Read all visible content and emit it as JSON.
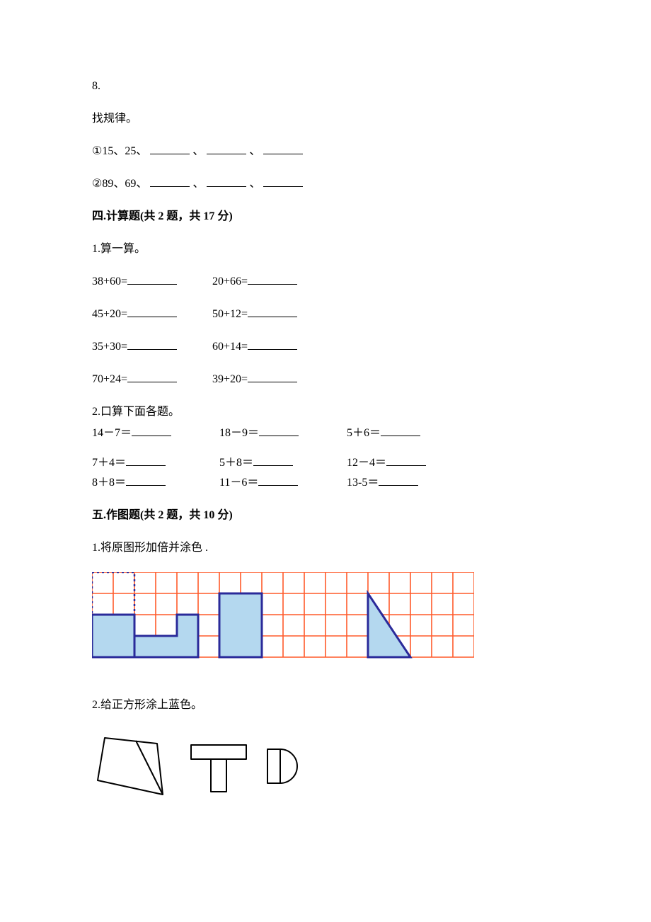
{
  "q8": {
    "number": "8.",
    "title": "找规律。",
    "seq1_prefix": "①15、25、",
    "seq2_prefix": "②89、69、",
    "sep": "、"
  },
  "section4": {
    "title": "四.计算题(共 2 题，共 17 分)",
    "q1": {
      "title": "1.算一算。",
      "rows": [
        [
          "38+60=",
          "20+66="
        ],
        [
          "45+20=",
          "50+12="
        ],
        [
          "35+30=",
          "60+14="
        ],
        [
          "70+24=",
          "39+20="
        ]
      ]
    },
    "q2": {
      "title": "2.口算下面各题。",
      "rows": [
        [
          "14－7＝",
          "18－9＝",
          "5＋6＝"
        ],
        [
          "7＋4＝",
          "5＋8＝",
          "12－4＝"
        ],
        [
          "8＋8＝",
          "11－6＝",
          "13-5＝"
        ]
      ]
    }
  },
  "section5": {
    "title": "五.作图题(共 2 题，共 10 分)",
    "q1": "1.将原图形加倍并涂色 .",
    "q2": "2.给正方形涂上蓝色。"
  },
  "chart_data": [
    {
      "type": "table",
      "title": "grid-figure",
      "grid_cols": 18,
      "grid_rows": 4,
      "shapes": [
        {
          "name": "dotted-square",
          "cells": [
            [
              0,
              0
            ],
            [
              1,
              0
            ],
            [
              0,
              1
            ],
            [
              1,
              1
            ]
          ],
          "fill": "none",
          "border": "dotted-blue"
        },
        {
          "name": "filled-rect-a",
          "cells": [
            [
              0,
              2
            ],
            [
              1,
              2
            ],
            [
              0,
              3
            ],
            [
              1,
              3
            ]
          ],
          "fill": "#b4d8ef",
          "border": "solid-blue"
        },
        {
          "name": "filled-L-b",
          "cells": [
            [
              2,
              3
            ],
            [
              3,
              3
            ],
            [
              4,
              3
            ],
            [
              4,
              2
            ]
          ],
          "fill": "#b4d8ef",
          "border": "solid-blue"
        },
        {
          "name": "filled-rect-c",
          "cells": [
            [
              6,
              1
            ],
            [
              7,
              1
            ],
            [
              6,
              2
            ],
            [
              7,
              2
            ],
            [
              6,
              3
            ],
            [
              7,
              3
            ]
          ],
          "fill": "#b4d8ef",
          "border": "solid-blue"
        },
        {
          "name": "filled-triangle-d",
          "polygon": [
            [
              13,
              1
            ],
            [
              13,
              4
            ],
            [
              15,
              4
            ]
          ],
          "fill": "#b4d8ef",
          "border": "solid-blue"
        }
      ]
    },
    {
      "type": "table",
      "title": "shapes-figure",
      "items": [
        {
          "name": "quad-with-diagonal",
          "components": [
            "quadrilateral",
            "diagonal-line"
          ]
        },
        {
          "name": "t-shape",
          "components": [
            "horizontal-rect",
            "vertical-rect"
          ]
        },
        {
          "name": "d-shape",
          "components": [
            "vertical-rect",
            "semicircle-right"
          ]
        }
      ]
    }
  ]
}
